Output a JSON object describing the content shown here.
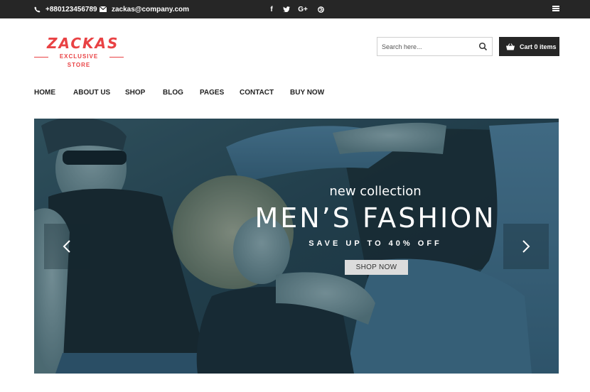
{
  "topbar": {
    "phone": "+880123456789",
    "email": "zackas@company.com",
    "social": [
      {
        "icon": "facebook-icon",
        "glyph": "f"
      },
      {
        "icon": "twitter-icon",
        "glyph": "t"
      },
      {
        "icon": "google-plus-icon",
        "glyph": "G+"
      },
      {
        "icon": "dribbble-icon",
        "glyph": "◎"
      }
    ],
    "menu_icon": "hamburger-icon"
  },
  "logo": {
    "name": "ZACKAS",
    "tagline": "EXCLUSIVE STORE"
  },
  "search": {
    "placeholder": "Search here...",
    "icon": "search-icon"
  },
  "cart": {
    "label": "Cart 0 items",
    "icon": "basket-icon"
  },
  "nav": {
    "items": [
      "HOME",
      "ABOUT US",
      "SHOP",
      "BLOG",
      "PAGES",
      "CONTACT",
      "BUY NOW"
    ]
  },
  "hero": {
    "subtitle": "new collection",
    "title": "MEN’S FASHION",
    "offer": "SAVE UP TO 40% OFF",
    "cta": "SHOP NOW",
    "prev_icon": "chevron-left-icon",
    "next_icon": "chevron-right-icon"
  },
  "colors": {
    "topbar_bg": "#262626",
    "brand_red": "#e94244",
    "hero_tint": "#2d5263"
  }
}
